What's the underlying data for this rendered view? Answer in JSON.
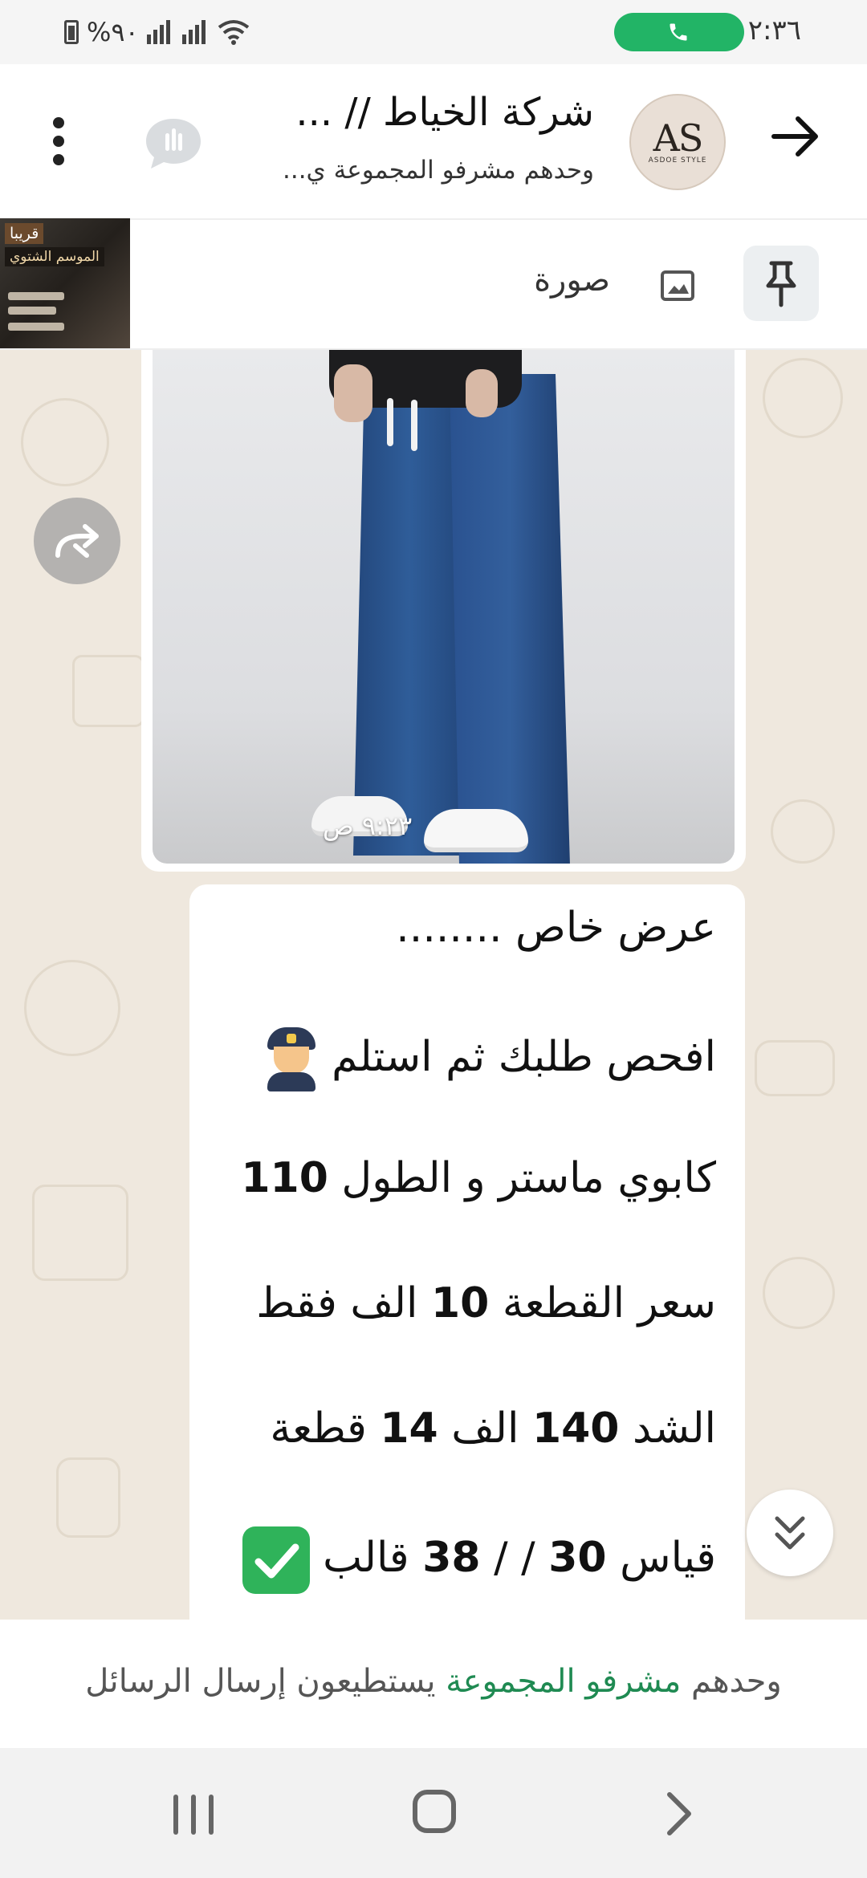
{
  "status_bar": {
    "time": "٢:٣٦",
    "battery": "%٩٠",
    "call_indicator": "phone-icon",
    "accent": "#22b466"
  },
  "header": {
    "title": "شركة الخياط // ...",
    "subtitle": "وحدهم مشرفو المجموعة ي...",
    "avatar_logo": "AS",
    "avatar_sub": "ASDOE STYLE"
  },
  "pinned": {
    "label": "صورة",
    "thumb_title": "قريبا",
    "thumb_sub": "الموسم الشتوي"
  },
  "messages": {
    "image_time": "٩:٢٣ ص",
    "line1": "عرض خاص ........",
    "line2_text": "افحص طلبك ثم استلم",
    "line3_text": "كابوي ماستر و الطول",
    "line3_num": "110",
    "line4_pre": "سعر القطعة",
    "line4_num": "10",
    "line4_post": "الف فقط",
    "line5_pre": "الشد",
    "line5_num1": "140",
    "line5_mid": "الف",
    "line5_num2": "14",
    "line5_post": "قطعة",
    "line6_pre": "قياس",
    "line6_num1": "30",
    "line6_mid": "/ /",
    "line6_num2": "38",
    "line6_post": "قالب"
  },
  "footer": {
    "notice_pre": "وحدهم",
    "notice_link": "مشرفو المجموعة",
    "notice_post": "يستطيعون إرسال الرسائل",
    "link_color": "#1f8a52"
  }
}
